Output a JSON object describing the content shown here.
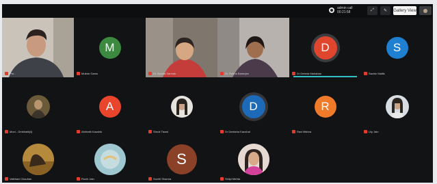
{
  "topbar": {
    "recording_line1": "admin call",
    "recording_line2": "00:21:58",
    "view_label": "Gallery View",
    "buttons": [
      "⤢",
      "✎"
    ]
  },
  "colors": {
    "background": "#121315",
    "mic_muted": "#e23c2e",
    "speaking": "#33c0c6"
  },
  "participants": [
    {
      "name": "Pre..",
      "type": "video",
      "row": 0,
      "col": 0
    },
    {
      "name": "Muktar Gams",
      "type": "initial",
      "initial": "M",
      "color": "#3b8a3f",
      "row": 0,
      "col": 1
    },
    {
      "name": "Dr. Asmita Sarmah",
      "type": "video",
      "row": 0,
      "col": 2
    },
    {
      "name": "Dr. Rekha Banerjee",
      "type": "video",
      "row": 0,
      "col": 3
    },
    {
      "name": "Dr Debeta Mahaldar",
      "type": "initial",
      "initial": "D",
      "color": "#e0452d",
      "row": 0,
      "col": 4
    },
    {
      "name": "Sachin Mallik",
      "type": "initial",
      "initial": "S",
      "color": "#1f7fd0",
      "row": 0,
      "col": 5
    },
    {
      "name": "Moni - Gmbhatti(4)",
      "type": "photo",
      "row": 1,
      "col": 0
    },
    {
      "name": "Abhirath Kaushik",
      "type": "initial",
      "initial": "A",
      "color": "#e9452c",
      "row": 1,
      "col": 1
    },
    {
      "name": "Shruti Tiwari",
      "type": "photo",
      "row": 1,
      "col": 2
    },
    {
      "name": "Dr Deeksha Kaushal",
      "type": "initial",
      "initial": "D",
      "color": "#1d6ab8",
      "row": 1,
      "col": 3
    },
    {
      "name": "Ravi Mishra",
      "type": "initial",
      "initial": "R",
      "color": "#ee7a2a",
      "row": 1,
      "col": 4
    },
    {
      "name": "Lily Jain",
      "type": "photo",
      "row": 1,
      "col": 5
    },
    {
      "name": "Vaibhavi Chauhan",
      "type": "photo",
      "row": 2,
      "col": 0
    },
    {
      "name": "Ruchi Jain",
      "type": "photo",
      "row": 2,
      "col": 1
    },
    {
      "name": "Suvriti Sharma",
      "type": "initial",
      "initial": "S",
      "color": "#8a4127",
      "row": 2,
      "col": 2
    },
    {
      "name": "Shilpi Mehta",
      "type": "photo",
      "row": 2,
      "col": 3
    }
  ]
}
